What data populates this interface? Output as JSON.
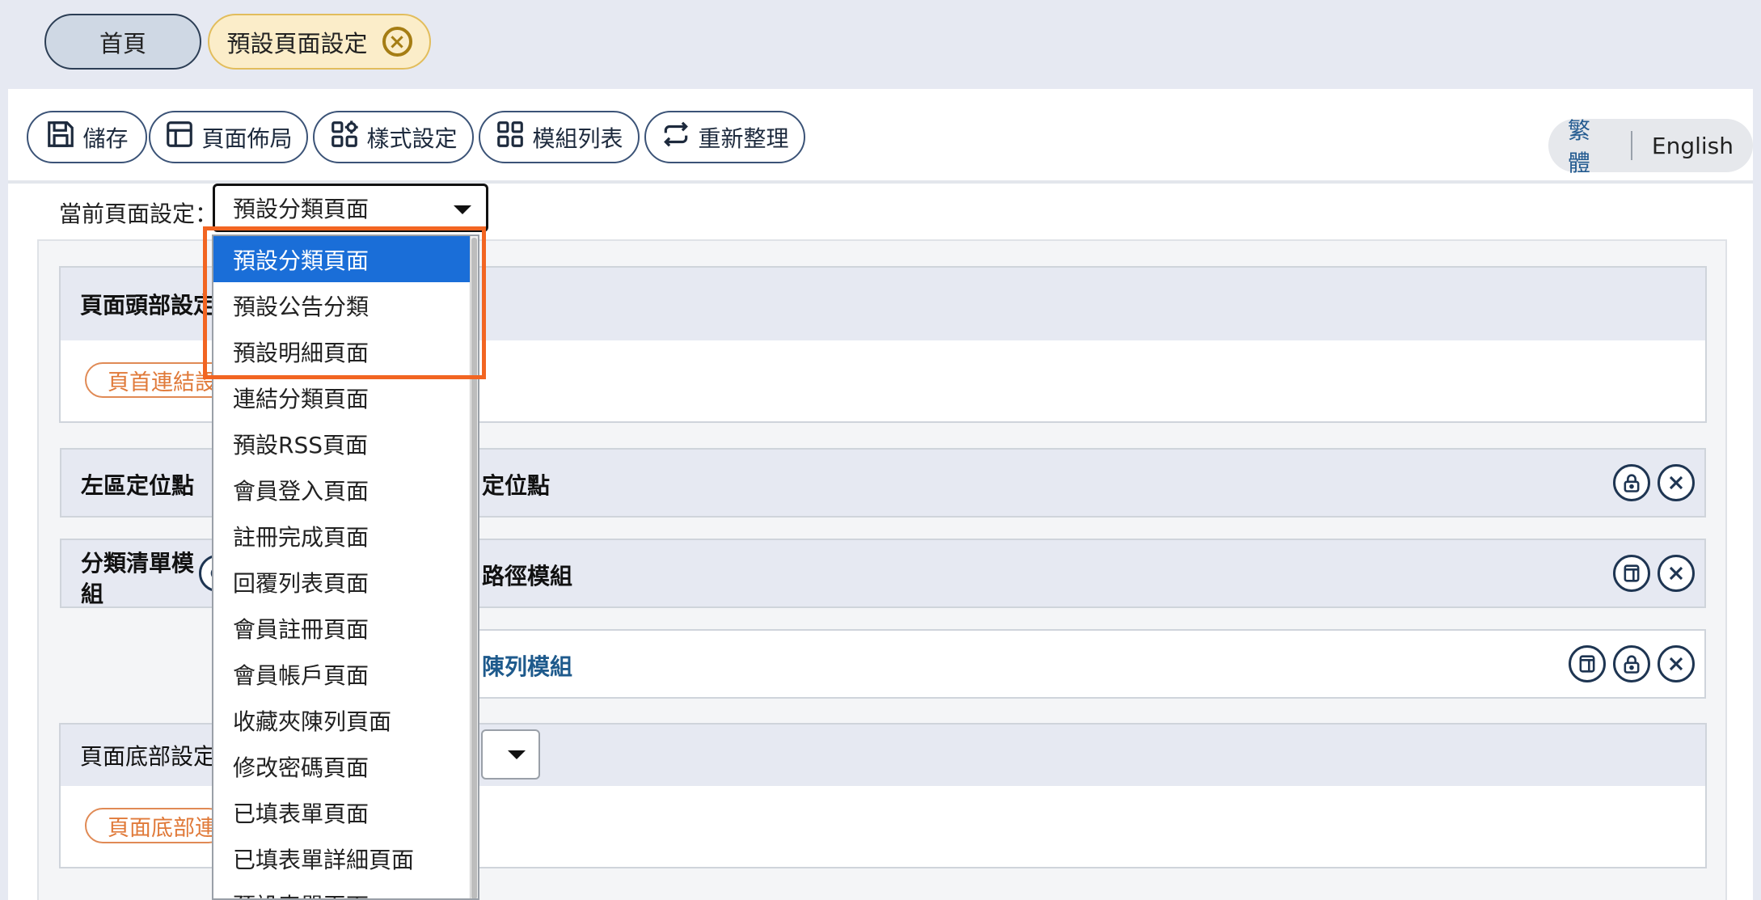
{
  "tabs": {
    "home_label": "首頁",
    "active_label": "預設頁面設定",
    "close_glyph": "×"
  },
  "toolbar": {
    "save_label": "儲存",
    "layout_label": "頁面佈局",
    "style_label": "樣式設定",
    "modules_label": "模組列表",
    "refresh_label": "重新整理",
    "icons": [
      "save-icon",
      "layout-icon",
      "style-icon",
      "grid-icon",
      "refresh-icon"
    ]
  },
  "language": {
    "zh": "繁體",
    "en": "English"
  },
  "page_setting": {
    "label": "當前頁面設定：",
    "selected": "預設分類頁面",
    "options": [
      "預設分類頁面",
      "預設公告分類",
      "預設明細頁面",
      "連結分類頁面",
      "預設RSS頁面",
      "會員登入頁面",
      "註冊完成頁面",
      "回覆列表頁面",
      "會員註冊頁面",
      "會員帳戶頁面",
      "收藏夾陳列頁面",
      "修改密碼頁面",
      "已填表單頁面",
      "已填表單詳細頁面",
      "預設表單頁面"
    ]
  },
  "header_section": {
    "title": "頁面頭部設定",
    "pill": "頁首連結設定"
  },
  "rows": {
    "left_anchor": "左區定位點",
    "main_anchor": "定位點",
    "category_module": "分類清單模組",
    "path_module": "路徑模組",
    "list_module": "陳列模組"
  },
  "footer_section": {
    "title": "頁面底部設定",
    "pill": "頁面底部連結設定"
  },
  "colors": {
    "accent_blue": "#1a6ed8",
    "highlight_orange": "#f26522",
    "pill_orange": "#e07a3a"
  }
}
